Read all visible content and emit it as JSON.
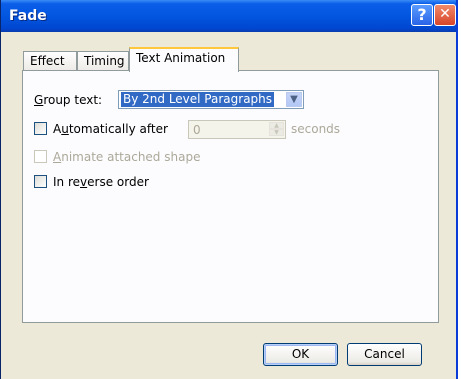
{
  "window": {
    "title": "Fade",
    "help_label": "?",
    "close_label": "✕"
  },
  "tabs": [
    {
      "label": "Effect",
      "active": false
    },
    {
      "label": "Timing",
      "active": false
    },
    {
      "label": "Text Animation",
      "active": true
    }
  ],
  "group_text": {
    "label_prefix": "G",
    "label_rest": "roup text:",
    "selected": "By 2nd Level Paragraphs"
  },
  "auto_after": {
    "label_a": "A",
    "label_u": "u",
    "label_rest": "tomatically after",
    "value": "0",
    "unit": "seconds",
    "checked": false
  },
  "animate_attached": {
    "label_prefix": "A",
    "label_rest": "nimate attached shape",
    "checked": false,
    "disabled": true
  },
  "reverse_order": {
    "label_a": "In re",
    "label_u": "v",
    "label_rest": "erse order",
    "checked": false
  },
  "buttons": {
    "ok": "OK",
    "cancel": "Cancel"
  }
}
